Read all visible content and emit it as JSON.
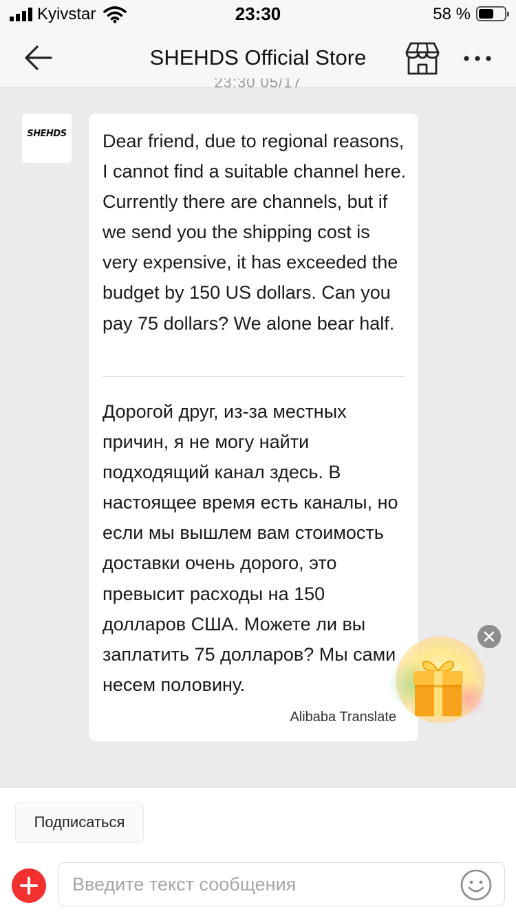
{
  "status_bar": {
    "carrier": "Kyivstar",
    "time": "23:30",
    "battery_percent": "58 %",
    "battery_level": 0.58
  },
  "header": {
    "title": "SHEHDS Official Store",
    "previous_timestamp_partial": "23:30 05/17"
  },
  "message": {
    "sender_logo_text": "SHEHDS",
    "original_text": "Dear friend, due to regional reasons, I cannot find a suitable channel here. Currently there are channels, but if we send you the shipping cost is very expensive, it has exceeded the budget by 150 US dollars. Can you pay 75 dollars? We alone bear half.",
    "translated_text": "Дорогой друг, из-за местных причин, я не могу найти подходящий канал здесь. В настоящее время есть каналы, но если мы вышлем вам стоимость доставки очень дорого, это превысит расходы на 150 долларов США. Можете ли вы заплатить 75 долларов? Мы сами несем половину.",
    "translation_credit": "Alibaba Translate"
  },
  "footer": {
    "subscribe_label": "Подписаться",
    "input_placeholder": "Введите текст сообщения",
    "input_value": ""
  },
  "colors": {
    "accent_red": "#f23030",
    "chat_background": "#ebebeb",
    "bubble_background": "#ffffff",
    "gift_orange": "#f7a21b"
  },
  "icons": {
    "back": "arrow-left-icon",
    "store": "storefront-icon",
    "more": "more-horizontal-icon",
    "add": "plus-circle-icon",
    "emoji": "smiley-icon",
    "gift": "gift-icon",
    "close": "close-icon"
  }
}
